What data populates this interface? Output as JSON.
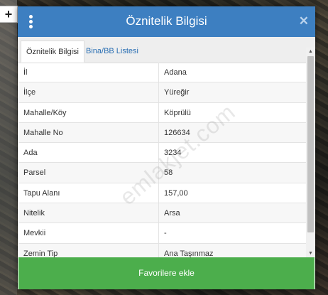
{
  "map": {
    "zoom_in_label": "+"
  },
  "dialog": {
    "title": "Öznitelik Bilgisi",
    "close_symbol": "✕",
    "tabs": [
      {
        "label": "Öznitelik Bilgisi",
        "active": true
      },
      {
        "label": "Bina/BB Listesi",
        "active": false
      }
    ],
    "rows": [
      {
        "key": "İl",
        "value": "Adana"
      },
      {
        "key": "İlçe",
        "value": "Yüreğir"
      },
      {
        "key": "Mahalle/Köy",
        "value": "Köprülü"
      },
      {
        "key": "Mahalle No",
        "value": "126634"
      },
      {
        "key": "Ada",
        "value": "3234"
      },
      {
        "key": "Parsel",
        "value": "58"
      },
      {
        "key": "Tapu Alanı",
        "value": "157,00"
      },
      {
        "key": "Nitelik",
        "value": "Arsa"
      },
      {
        "key": "Mevkii",
        "value": "-"
      },
      {
        "key": "Zemin Tip",
        "value": "Ana Taşınmaz"
      }
    ],
    "footer_button": "Favorilere ekle"
  },
  "watermark": "emlakjet.com",
  "colors": {
    "header": "#3d7fc1",
    "footer": "#4cae4c"
  }
}
